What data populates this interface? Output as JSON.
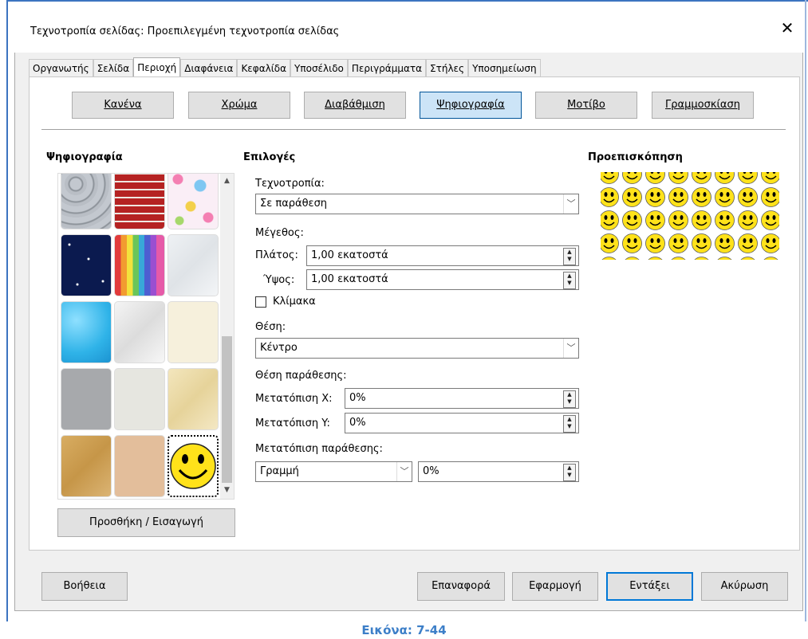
{
  "dialog": {
    "title": "Τεχνοτροπία σελίδας: Προεπιλεγμένη τεχνοτροπία σελίδας",
    "close_glyph": "✕"
  },
  "tabs": [
    {
      "label": "Οργανωτής",
      "active": false
    },
    {
      "label": "Σελίδα",
      "active": false
    },
    {
      "label": "Περιοχή",
      "active": true
    },
    {
      "label": "Διαφάνεια",
      "active": false
    },
    {
      "label": "Κεφαλίδα",
      "active": false
    },
    {
      "label": "Υποσέλιδο",
      "active": false
    },
    {
      "label": "Περιγράμματα",
      "active": false
    },
    {
      "label": "Στήλες",
      "active": false
    },
    {
      "label": "Υποσημείωση",
      "active": false
    }
  ],
  "fill_types": [
    {
      "label": "Κανένα",
      "active": false
    },
    {
      "label": "Χρώμα",
      "active": false
    },
    {
      "label": "Διαβάθμιση",
      "active": false
    },
    {
      "label": "Ψηφιογραφία",
      "active": true
    },
    {
      "label": "Μοτίβο",
      "active": false
    },
    {
      "label": "Γραμμοσκίαση",
      "active": false
    }
  ],
  "bitmap_section": {
    "header": "Ψηφιογραφία",
    "tiles": [
      "stone",
      "brick",
      "flowers",
      "night-sky",
      "color-pencils",
      "white-paper",
      "water",
      "white-diffusion",
      "cream-paper",
      "gray-concrete",
      "light-gray",
      "parchment",
      "sand",
      "beige",
      "smiley"
    ],
    "selected_tile": "smiley",
    "add_button": "Προσθήκη / Εισαγωγή"
  },
  "options": {
    "header": "Επιλογές",
    "style_label": "Τεχνοτροπία:",
    "style_value": "Σε παράθεση",
    "size_label": "Μέγεθος:",
    "width_label": "Πλάτος:",
    "width_value": "1,00 εκατοστά",
    "height_label": "Ύψος:",
    "height_value": "1,00 εκατοστά",
    "scale_label": "Κλίμακα",
    "scale_checked": false,
    "position_label": "Θέση:",
    "position_value": "Κέντρο",
    "tile_position_label": "Θέση παράθεσης:",
    "offset_x_label": "Μετατόπιση X:",
    "offset_x_value": "0%",
    "offset_y_label": "Μετατόπιση Y:",
    "offset_y_value": "0%",
    "tile_offset_label": "Μετατόπιση παράθεσης:",
    "tile_offset_type": "Γραμμή",
    "tile_offset_value": "0%"
  },
  "preview": {
    "header": "Προεπισκόπηση"
  },
  "buttons": {
    "help": "Βοήθεια",
    "reset": "Επαναφορά",
    "apply": "Εφαρμογή",
    "ok": "Εντάξει",
    "cancel": "Ακύρωση"
  },
  "caption": "Εικόνα: 7-44",
  "colors": {
    "accent": "#0078d7",
    "selected_tab_bg": "#cce4f7",
    "caption": "#3d7fc8",
    "smiley": "#ffe21a"
  }
}
